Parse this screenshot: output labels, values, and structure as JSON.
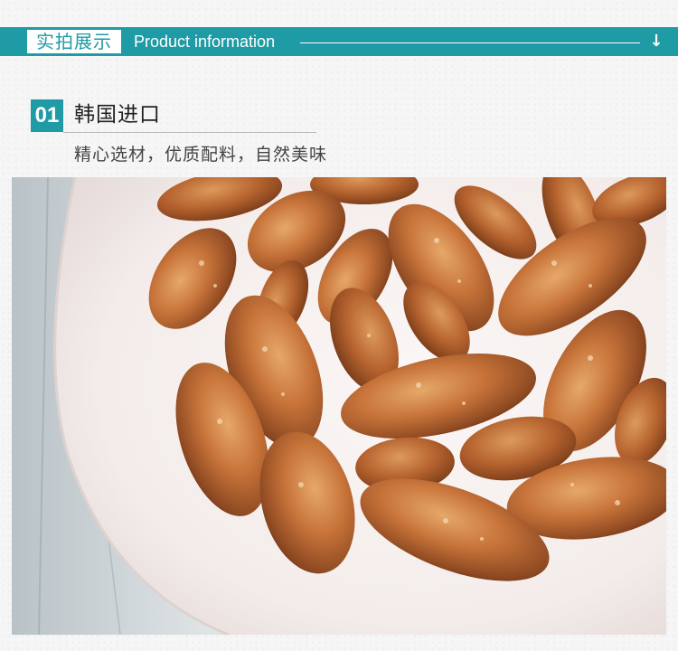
{
  "banner": {
    "title_cn": "实拍展示",
    "title_en": "Product information",
    "arrow_icon": "down-arrow-icon",
    "color": "#1e9ba4"
  },
  "section": {
    "number": "01",
    "title": "韩国进口",
    "subtitle": "精心选材，优质配料，自然美味"
  },
  "photo": {
    "subject": "honey butter almonds"
  }
}
